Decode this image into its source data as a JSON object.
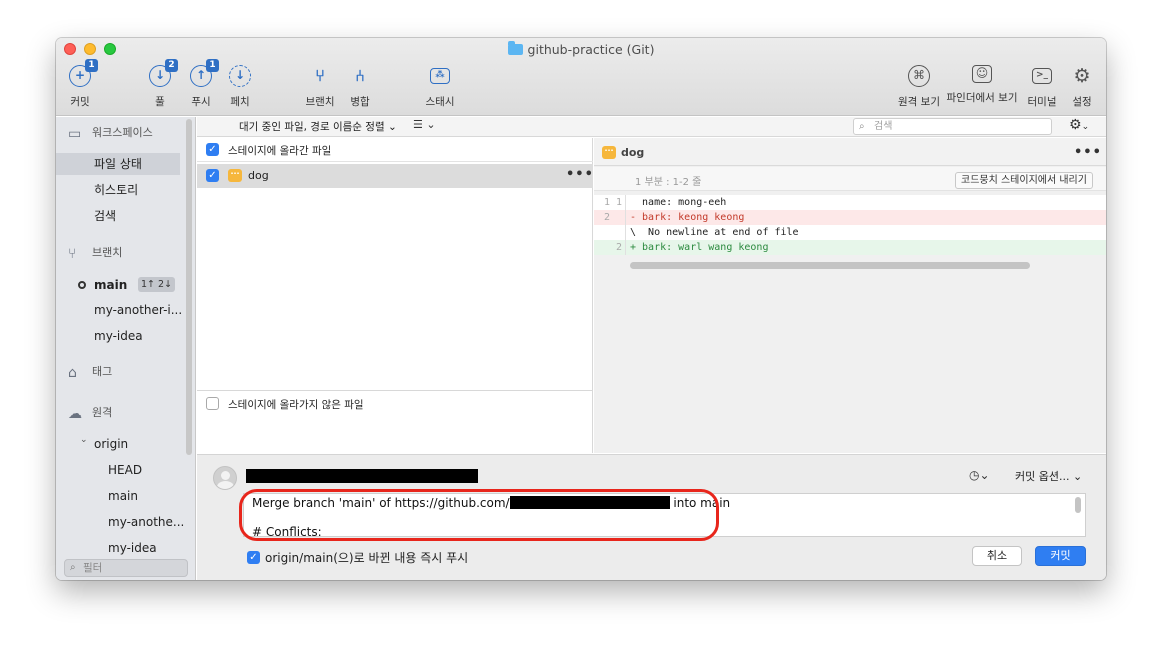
{
  "window": {
    "title": "github-practice (Git)"
  },
  "toolbar": {
    "commit": {
      "label": "커밋",
      "badge": "1"
    },
    "pull": {
      "label": "풀",
      "badge": "2"
    },
    "push": {
      "label": "푸시",
      "badge": "1"
    },
    "fetch": {
      "label": "페치"
    },
    "branch": {
      "label": "브랜치"
    },
    "merge": {
      "label": "병합"
    },
    "stash": {
      "label": "스태시"
    },
    "remote_view": {
      "label": "원격 보기"
    },
    "finder_view": {
      "label": "파인더에서 보기"
    },
    "terminal": {
      "label": "터미널"
    },
    "settings": {
      "label": "설정"
    }
  },
  "sidebar": {
    "workspace": {
      "label": "워크스페이스",
      "items": [
        "파일 상태",
        "히스토리",
        "검색"
      ]
    },
    "branches": {
      "label": "브랜치",
      "items": [
        {
          "name": "main",
          "badge": "1↑ 2↓"
        },
        {
          "name": "my-another-i..."
        },
        {
          "name": "my-idea"
        }
      ]
    },
    "tags": {
      "label": "태그"
    },
    "remotes": {
      "label": "원격",
      "origin": "origin",
      "items": [
        "HEAD",
        "main",
        "my-anothe...",
        "my-idea"
      ]
    },
    "filter_placeholder": "필터"
  },
  "filterbar": {
    "sort_label": "대기 중인 파일, 경로 이름순 정렬",
    "search_placeholder": "검색"
  },
  "files": {
    "staged_header": "스테이지에 올라간 파일",
    "staged": [
      {
        "name": "dog",
        "checked": true
      }
    ],
    "unstaged_header": "스테이지에 올라가지 않은 파일"
  },
  "diff": {
    "file": "dog",
    "hunk_label": "1 부분 : 1-2 줄",
    "unstage_button": "코드뭉치 스테이지에서 내리기",
    "lines": [
      {
        "old": "1",
        "new": "1",
        "type": "ctx",
        "text": "  name: mong-eeh"
      },
      {
        "old": "2",
        "new": "",
        "type": "del",
        "text": "- bark: keong keong"
      },
      {
        "old": "",
        "new": "",
        "type": "ctx",
        "text": "\\  No newline at end of file"
      },
      {
        "old": "",
        "new": "2",
        "type": "add",
        "text": "+ bark: warl wang keong"
      }
    ]
  },
  "commit": {
    "options_label": "커밋 옵션...",
    "message_line1_prefix": "Merge branch 'main' of https://github.com/",
    "message_line1_suffix": " into main",
    "message_line2": "# Conflicts:",
    "push_label": "origin/main(으)로 바뀐 내용 즉시 푸시",
    "cancel_button": "취소",
    "commit_button": "커밋"
  },
  "colors": {
    "accent": "#2f7ef2",
    "highlight_ring": "#e8261c",
    "deleted": "#c33a2a",
    "added": "#2c8a3f"
  }
}
